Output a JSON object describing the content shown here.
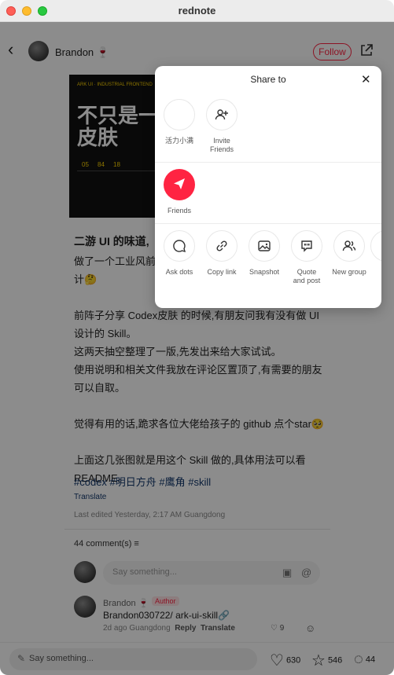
{
  "window": {
    "title": "rednote"
  },
  "header": {
    "author_name": "Brandon 🍷",
    "follow_label": "Follow"
  },
  "cover": {
    "title_text": "不只是一套\n皮肤",
    "top_label": "ARK UI · INDUSTRIAL FRONTEND",
    "numbers": "05     84     18"
  },
  "post": {
    "title": "二游 UI 的味道,",
    "lines": [
      "做了一个工业风前端",
      "计🤔",
      "",
      "前阵子分享 Codex皮肤 的时候,有朋友问我有没有做 UI",
      "设计的 Skill。",
      "这两天抽空整理了一版,先发出来给大家试试。",
      "使用说明和相关文件我放在评论区置顶了,有需要的朋友",
      "可以自取。",
      "",
      "觉得有用的话,跪求各位大佬给孩子的 github 点个star🥺",
      "",
      "上面这几张图就是用这个 Skill 做的,具体用法可以看",
      "README。"
    ],
    "tags": "#codex #明日方舟  #鹰角  #skill",
    "translate_label": "Translate",
    "edited": "Last edited Yesterday, 2:17 AM Guangdong"
  },
  "comments": {
    "count_label": "44 comment(s) ≡",
    "input_placeholder": "Say something...",
    "items": [
      {
        "name": "Brandon 🍷",
        "badge": "Author",
        "text": "Brandon030722/ ark-ui-skill🔗",
        "meta": "2d ago Guangdong",
        "reply_label": "Reply",
        "translate_label": "Translate",
        "likes": "9"
      }
    ]
  },
  "bottombar": {
    "input_placeholder": "Say something...",
    "likes": "630",
    "stars": "546",
    "comments": "44"
  },
  "share_sheet": {
    "title": "Share to",
    "row1": [
      {
        "label": "活力小满",
        "icon": "friend-avatar"
      },
      {
        "label": "Invite\nFriends",
        "icon": "add-person-icon"
      }
    ],
    "row2": [
      {
        "label": "Friends",
        "icon": "send-icon"
      }
    ],
    "row3": [
      {
        "label": "Ask dots",
        "icon": "chat-bubble-icon"
      },
      {
        "label": "Copy link",
        "icon": "link-icon"
      },
      {
        "label": "Snapshot",
        "icon": "image-icon"
      },
      {
        "label": "Quote\nand post",
        "icon": "quote-icon"
      },
      {
        "label": "New group",
        "icon": "group-icon"
      }
    ]
  },
  "colors": {
    "accent": "#ff2442",
    "link": "#13386c",
    "overlay": "rgba(0,0,0,0.45)"
  }
}
